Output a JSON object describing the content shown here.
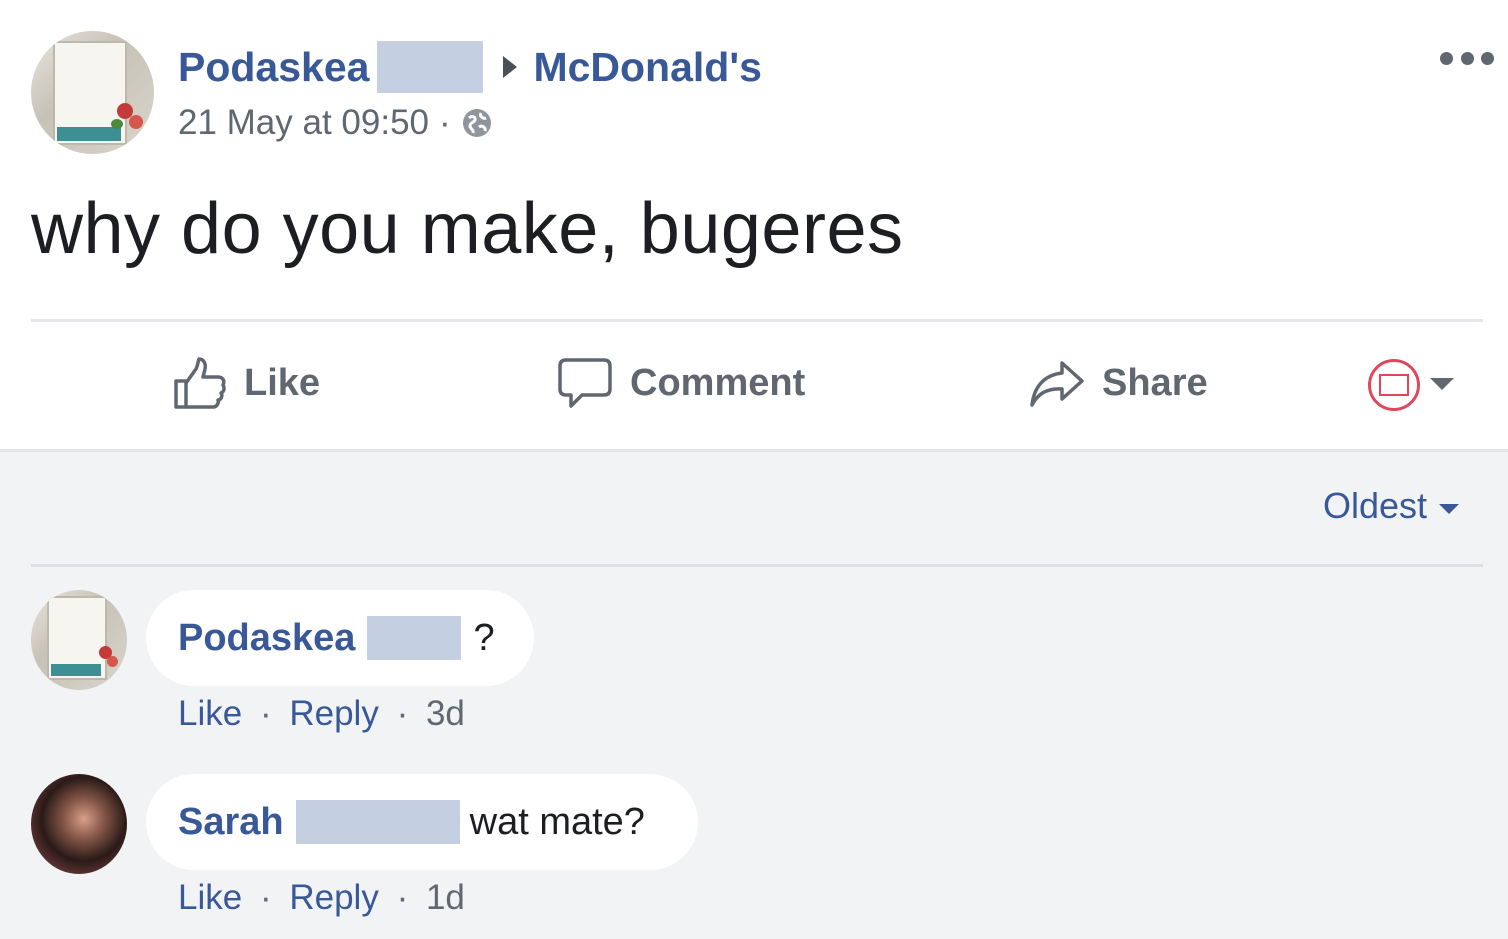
{
  "post": {
    "author": "Podaskea",
    "target_page": "McDonald's",
    "timestamp": "21 May at 09:50",
    "separator": "·",
    "privacy_icon": "globe-icon",
    "text": "why do you make, bugeres",
    "more_icon": "ellipsis-icon"
  },
  "actions": {
    "like": "Like",
    "comment": "Comment",
    "share": "Share"
  },
  "sort": {
    "label": "Oldest"
  },
  "comments": [
    {
      "author": "Podaskea",
      "text": "?",
      "like": "Like",
      "reply": "Reply",
      "age": "3d"
    },
    {
      "author": "Sarah",
      "text": "wat mate?",
      "like": "Like",
      "reply": "Reply",
      "age": "1d"
    }
  ],
  "colors": {
    "link": "#385898",
    "redaction": "#c4d0e2",
    "comments_bg": "#f2f3f5",
    "muted": "#606770"
  }
}
